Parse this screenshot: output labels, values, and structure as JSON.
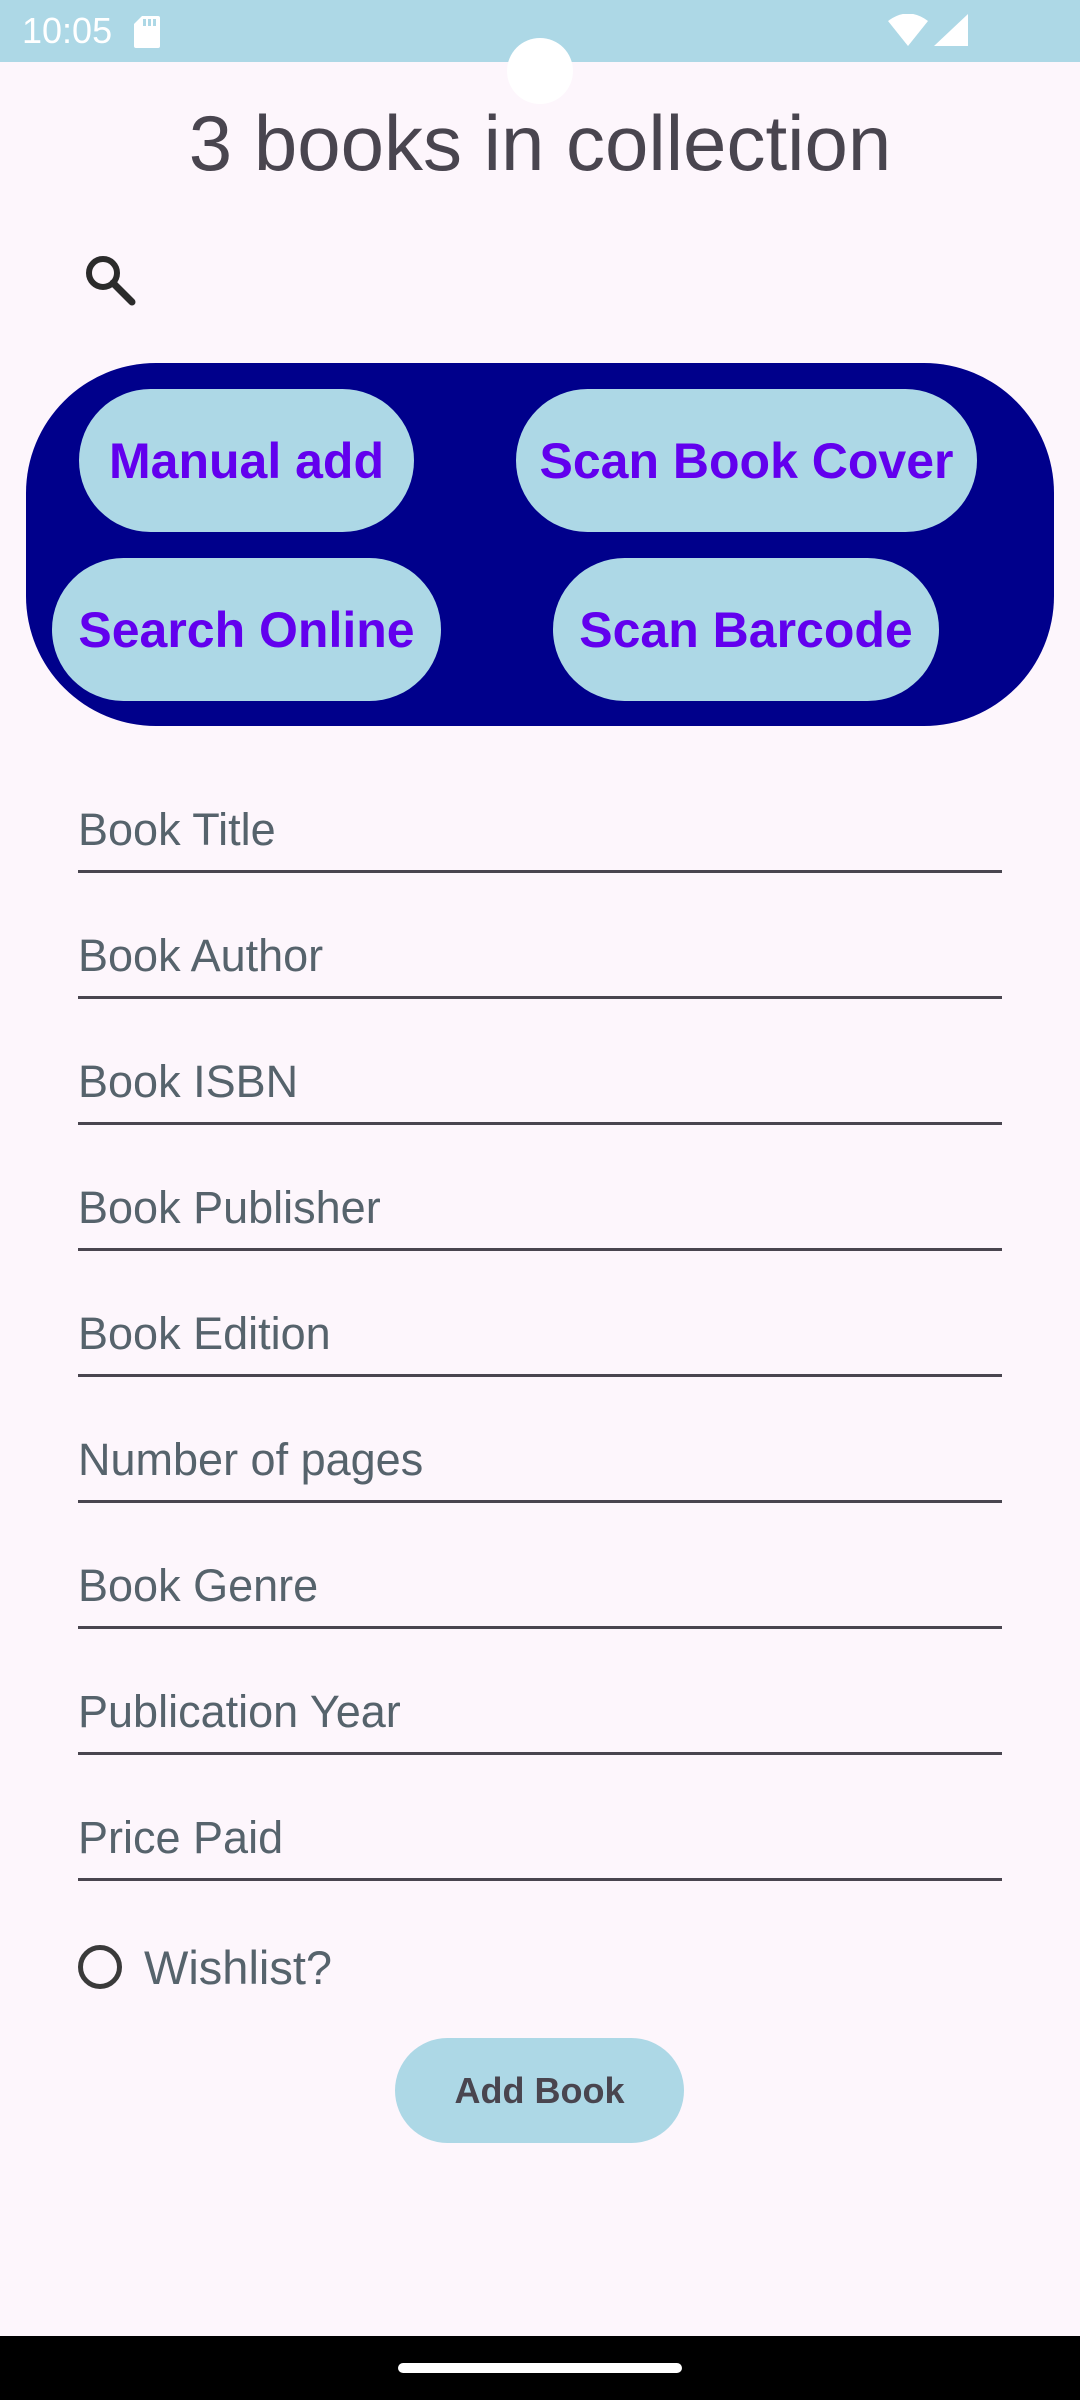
{
  "status_bar": {
    "time": "10:05",
    "icons": [
      "sd-card-icon",
      "wifi-icon",
      "signal-icon"
    ]
  },
  "header": {
    "title": "3 books in collection",
    "search_icon": "search-icon"
  },
  "actions": {
    "manual_add": "Manual add",
    "scan_cover": "Scan Book Cover",
    "search_online": "Search Online",
    "scan_barcode": "Scan Barcode"
  },
  "form": {
    "fields": [
      {
        "placeholder": "Book Title",
        "value": ""
      },
      {
        "placeholder": "Book Author",
        "value": ""
      },
      {
        "placeholder": "Book ISBN",
        "value": ""
      },
      {
        "placeholder": "Book Publisher",
        "value": ""
      },
      {
        "placeholder": "Book Edition",
        "value": ""
      },
      {
        "placeholder": "Number of pages",
        "value": ""
      },
      {
        "placeholder": "Book Genre",
        "value": ""
      },
      {
        "placeholder": "Publication Year",
        "value": ""
      },
      {
        "placeholder": "Price Paid",
        "value": ""
      }
    ],
    "wishlist_label": "Wishlist?",
    "wishlist_checked": false,
    "add_button": "Add Book"
  },
  "colors": {
    "status_bar": "#add8e6",
    "panel": "#00008b",
    "pill": "#add8e6",
    "pill_text": "#6200ee",
    "background": "#fdf6fc"
  }
}
